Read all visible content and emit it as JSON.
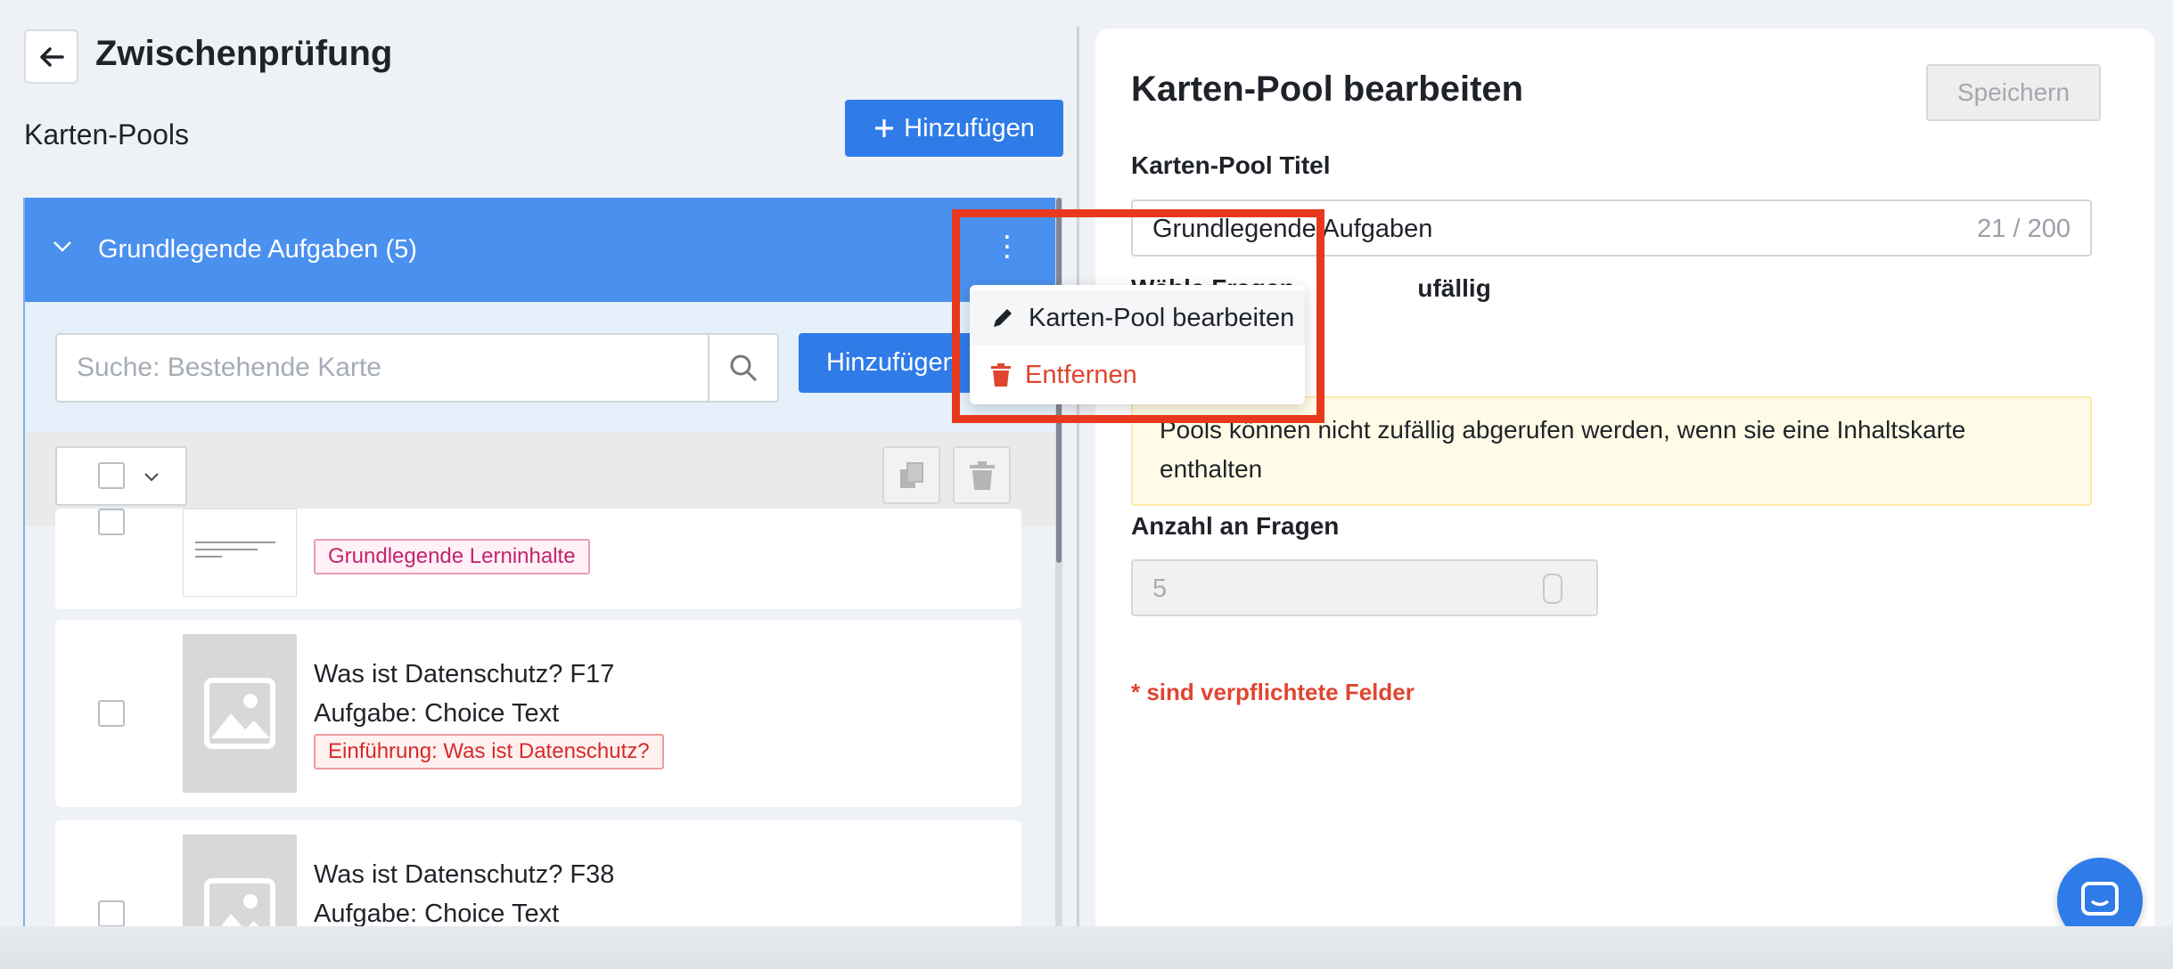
{
  "header": {
    "title": "Zwischenprüfung",
    "back_icon": "arrow-left-icon"
  },
  "pools_section": {
    "label": "Karten-Pools",
    "add_button": "Hinzufügen",
    "pool": {
      "title": "Grundlegende Aufgaben (5)",
      "search_placeholder": "Suche: Bestehende Karte",
      "add_card_button": "Hinzufügen"
    },
    "cards": [
      {
        "tag": "Grundlegende Lerninhalte"
      },
      {
        "title": "Was ist Datenschutz? F17",
        "subtitle": "Aufgabe: Choice Text",
        "tag": "Einführung: Was ist Datenschutz?"
      },
      {
        "title": "Was ist Datenschutz? F38",
        "subtitle": "Aufgabe: Choice Text"
      }
    ]
  },
  "context_menu": {
    "edit": "Karten-Pool bearbeiten",
    "remove": "Entfernen"
  },
  "editor": {
    "title": "Karten-Pool bearbeiten",
    "save_button": "Speichern",
    "pool_title_label": "Karten-Pool Titel",
    "pool_title_value": "Grundlegende Aufgaben",
    "pool_title_counter": "21 / 200",
    "random_label_fragment_1": "Wähle Fragen",
    "random_label_fragment_2": "ufällig",
    "warning": "Pools können nicht zufällig abgerufen werden, wenn sie eine Inhaltskarte enthalten",
    "count_label": "Anzahl an Fragen",
    "count_value": "5",
    "required_note": "* sind verpflichtete Felder"
  },
  "colors": {
    "primary": "#2f7be8",
    "pool_header": "#4a90ee",
    "highlight": "#e8391f",
    "danger": "#e0452f"
  }
}
